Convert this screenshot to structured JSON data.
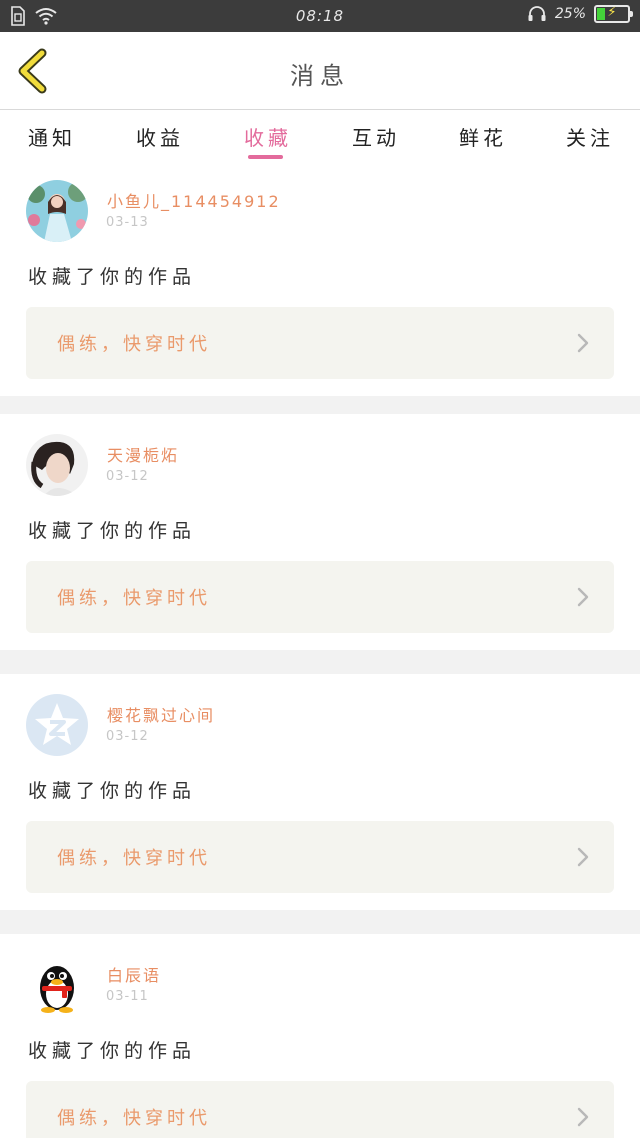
{
  "status_bar": {
    "time": "08:18",
    "battery_percent": "25%",
    "battery_level": 0.25,
    "icons": [
      "sim-icon",
      "wifi-icon",
      "headset-icon",
      "battery-charging-icon"
    ]
  },
  "header": {
    "title": "消息",
    "back_icon": "chevron-left-icon"
  },
  "tabs": [
    {
      "label": "通知",
      "active": false
    },
    {
      "label": "收益",
      "active": false
    },
    {
      "label": "收藏",
      "active": true
    },
    {
      "label": "互动",
      "active": false
    },
    {
      "label": "鲜花",
      "active": false
    },
    {
      "label": "关注",
      "active": false
    }
  ],
  "colors": {
    "accent": "#e36b9c",
    "username": "#e88e63",
    "work_title": "#ea9a6c",
    "work_bg": "#f4f4ef",
    "status_bar": "#3c3c3c"
  },
  "items": [
    {
      "username": "小鱼儿_114454912",
      "date": "03-13",
      "action": "收藏了你的作品",
      "work_title": "偶练，快穿时代",
      "avatar": "girl-photo-avatar"
    },
    {
      "username": "天漫栀炻",
      "date": "03-12",
      "action": "收藏了你的作品",
      "work_title": "偶练，快穿时代",
      "avatar": "portrait-photo-avatar"
    },
    {
      "username": "樱花飘过心间",
      "date": "03-12",
      "action": "收藏了你的作品",
      "work_title": "偶练，快穿时代",
      "avatar": "default-star-avatar"
    },
    {
      "username": "白辰语",
      "date": "03-11",
      "action": "收藏了你的作品",
      "work_title": "偶练，快穿时代",
      "avatar": "qq-penguin-avatar"
    }
  ]
}
